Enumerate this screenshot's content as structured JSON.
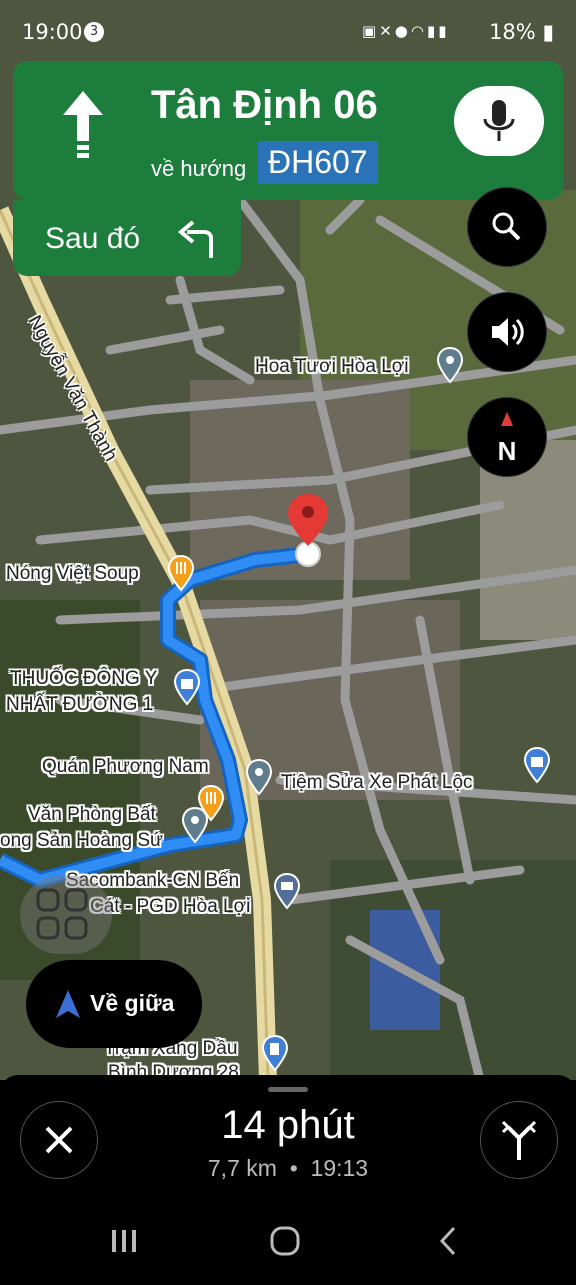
{
  "status_bar": {
    "time": "19:00",
    "notification_count": "3",
    "battery": "18%",
    "icons": [
      "media-icon",
      "mute-icon",
      "location-icon",
      "wifi-icon",
      "signal-icon",
      "signal-icon",
      "battery-icon"
    ]
  },
  "navigation": {
    "street": "Tân Định 06",
    "toward_label": "về hướng",
    "toward_road": "ĐH607",
    "maneuver_icon": "straight-arrow-icon",
    "then_label": "Sau đó",
    "then_icon": "turn-left-arrow-icon"
  },
  "map": {
    "road_label": "Nguyễn Văn Thành",
    "places": [
      {
        "name": "Hoa Tươi Hòa Lợi",
        "icon": "pin-icon"
      },
      {
        "name": "Nóng Việt Soup",
        "icon": "restaurant-icon"
      },
      {
        "name": "THUỐC ĐÔNG Y",
        "icon": "shopping-bag-icon"
      },
      {
        "name": "NHẤT ĐƯỜNG 1",
        "icon": ""
      },
      {
        "name": "Quán Phương Nam",
        "icon": "pin-icon"
      },
      {
        "name": "Tiệm Sửa Xe Phát Lộc",
        "icon": "pin-icon"
      },
      {
        "name": "Văn Phòng Bất",
        "icon": "restaurant-icon"
      },
      {
        "name": "ong Sản Hoàng Sứ",
        "icon": "pin-icon"
      },
      {
        "name": "Sacombank-CN Bến",
        "icon": "bank-icon"
      },
      {
        "name": "Cát - PGD Hòa Lợi",
        "icon": ""
      },
      {
        "name": "Trạm Xăng Dầu",
        "icon": "gas-station-icon"
      },
      {
        "name": "Bình Dương 28",
        "icon": ""
      }
    ],
    "colors": {
      "route": "#2f8df5",
      "nav_green": "#1c7d3c",
      "road_chip": "#2a73b8",
      "destination": "#e53935"
    }
  },
  "map_controls": [
    "search-icon",
    "sound-icon",
    "compass-icon"
  ],
  "compass_label": "N",
  "recenter_label": "Về giữa",
  "trip": {
    "duration": "14 phút",
    "distance": "7,7 km",
    "separator": "•",
    "arrival": "19:13"
  }
}
